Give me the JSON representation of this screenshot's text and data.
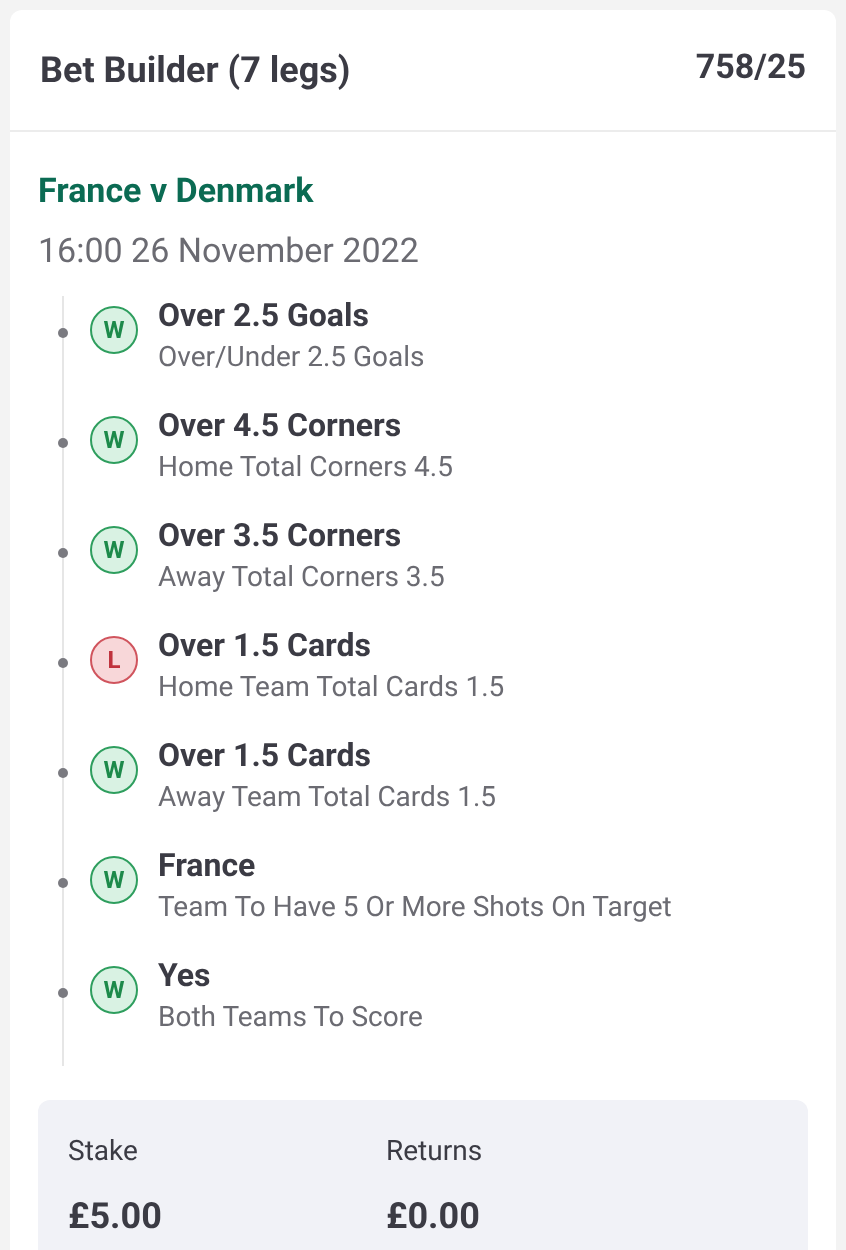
{
  "header": {
    "title": "Bet Builder (7 legs)",
    "odds": "758/25"
  },
  "event": {
    "name": "France v Denmark",
    "time": "16:00 26 November 2022"
  },
  "legs": [
    {
      "result": "W",
      "kind": "win",
      "selection": "Over 2.5 Goals",
      "market": "Over/Under 2.5 Goals"
    },
    {
      "result": "W",
      "kind": "win",
      "selection": "Over 4.5 Corners",
      "market": "Home Total Corners 4.5"
    },
    {
      "result": "W",
      "kind": "win",
      "selection": "Over 3.5 Corners",
      "market": "Away Total Corners 3.5"
    },
    {
      "result": "L",
      "kind": "loss",
      "selection": "Over 1.5 Cards",
      "market": "Home Team Total Cards 1.5"
    },
    {
      "result": "W",
      "kind": "win",
      "selection": "Over 1.5 Cards",
      "market": "Away Team Total Cards 1.5"
    },
    {
      "result": "W",
      "kind": "win",
      "selection": "France",
      "market": "Team To Have 5 Or More Shots On Target"
    },
    {
      "result": "W",
      "kind": "win",
      "selection": "Yes",
      "market": "Both Teams To Score"
    }
  ],
  "summary": [
    {
      "label": "Stake",
      "value": "£5.00"
    },
    {
      "label": "Returns",
      "value": "£0.00"
    }
  ]
}
